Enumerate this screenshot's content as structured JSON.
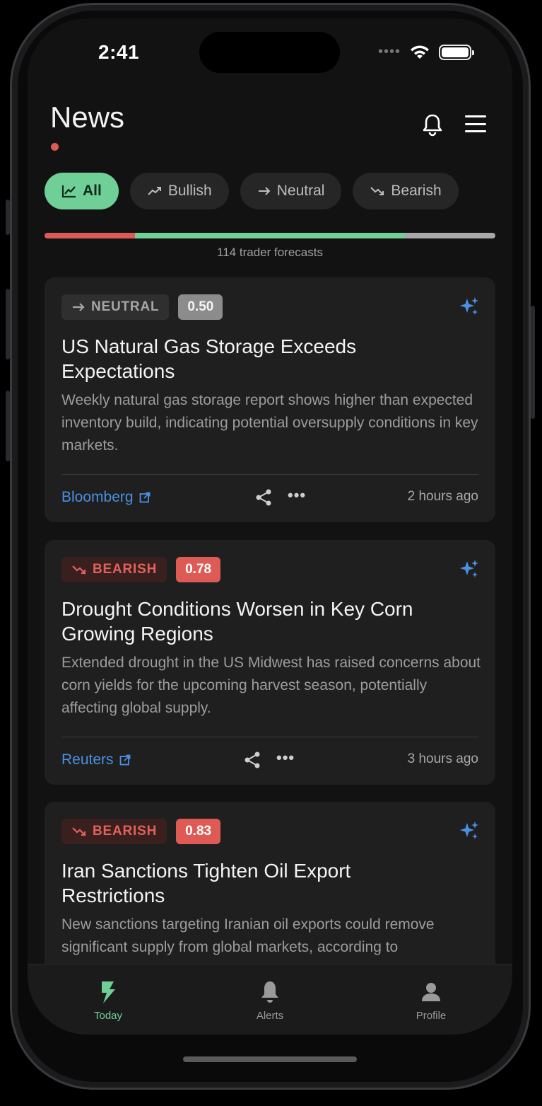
{
  "status_bar": {
    "time": "2:41",
    "signal_dots": "••••"
  },
  "header": {
    "title": "News"
  },
  "filters": [
    {
      "label": "All",
      "icon": "chart-line-icon",
      "active": true
    },
    {
      "label": "Bullish",
      "icon": "trending-up-icon",
      "active": false
    },
    {
      "label": "Neutral",
      "icon": "arrow-right-icon",
      "active": false
    },
    {
      "label": "Bearish",
      "icon": "trending-down-icon",
      "active": false
    }
  ],
  "forecast": {
    "label": "114 trader forecasts",
    "distribution": {
      "bearish": 0.2,
      "bullish": 0.6,
      "neutral": 0.2
    },
    "colors": {
      "bearish": "#e05a55",
      "bullish": "#6fcf97",
      "neutral": "#a8a8a8"
    }
  },
  "cards": [
    {
      "sentiment": "NEUTRAL",
      "sentiment_icon": "arrow-right-icon",
      "score": "0.50",
      "title": "US Natural Gas Storage Exceeds Expectations",
      "description": "Weekly natural gas storage report shows higher than expected inventory build, indicating potential oversupply conditions in key markets.",
      "source": "Bloomberg",
      "time_ago": "2 hours ago"
    },
    {
      "sentiment": "BEARISH",
      "sentiment_icon": "trending-down-icon",
      "score": "0.78",
      "title": "Drought Conditions Worsen in Key Corn Growing Regions",
      "description": "Extended drought in the US Midwest has raised concerns about corn yields for the upcoming harvest season, potentially affecting global supply.",
      "source": "Reuters",
      "time_ago": "3 hours ago"
    },
    {
      "sentiment": "BEARISH",
      "sentiment_icon": "trending-down-icon",
      "score": "0.83",
      "title": "Iran Sanctions Tighten Oil Export Restrictions",
      "description": "New sanctions targeting Iranian oil exports could remove significant supply from global markets, according to"
    }
  ],
  "tabbar": {
    "items": [
      {
        "label": "Today",
        "icon": "bolt-icon",
        "active": true
      },
      {
        "label": "Alerts",
        "icon": "bell-icon",
        "active": false
      },
      {
        "label": "Profile",
        "icon": "person-icon",
        "active": false
      }
    ]
  },
  "colors": {
    "accent": "#6fcf97",
    "bearish": "#e05a55",
    "link": "#4a90e2",
    "sparkle": "#4a90e2"
  }
}
